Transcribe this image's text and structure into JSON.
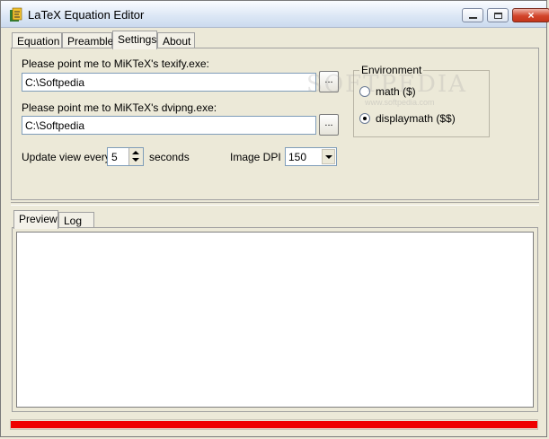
{
  "window": {
    "title": "LaTeX Equation Editor",
    "app_icon": "latex-app-icon",
    "caption_buttons": {
      "minimize": "minimize-icon",
      "maximize": "maximize-icon",
      "close": "×"
    }
  },
  "top_tabs": [
    {
      "label": "Equation",
      "active": false
    },
    {
      "label": "Preamble",
      "active": false
    },
    {
      "label": "Settings",
      "active": true
    },
    {
      "label": "About",
      "active": false
    }
  ],
  "settings": {
    "texify_label": "Please point me to MiKTeX's texify.exe:",
    "texify_path": "C:\\Softpedia",
    "dvipng_label": "Please point me to MiKTeX's dvipng.exe:",
    "dvipng_path": "C:\\Softpedia",
    "browse_label": "...",
    "environment": {
      "title": "Environment",
      "options": [
        {
          "label": "math ($)",
          "checked": false
        },
        {
          "label": "displaymath ($$)",
          "checked": true
        }
      ]
    },
    "update_label": "Update view every",
    "update_value": "5",
    "update_unit": "seconds",
    "dpi_label": "Image DPI",
    "dpi_value": "150"
  },
  "bottom_tabs": [
    {
      "label": "Preview",
      "active": true
    },
    {
      "label": "Log",
      "active": false
    }
  ],
  "statusbar": {
    "progress": 1.0,
    "color": "#ef0000"
  },
  "watermark": {
    "text": "SOFTPEDIA",
    "sub": "www.softpedia.com"
  }
}
